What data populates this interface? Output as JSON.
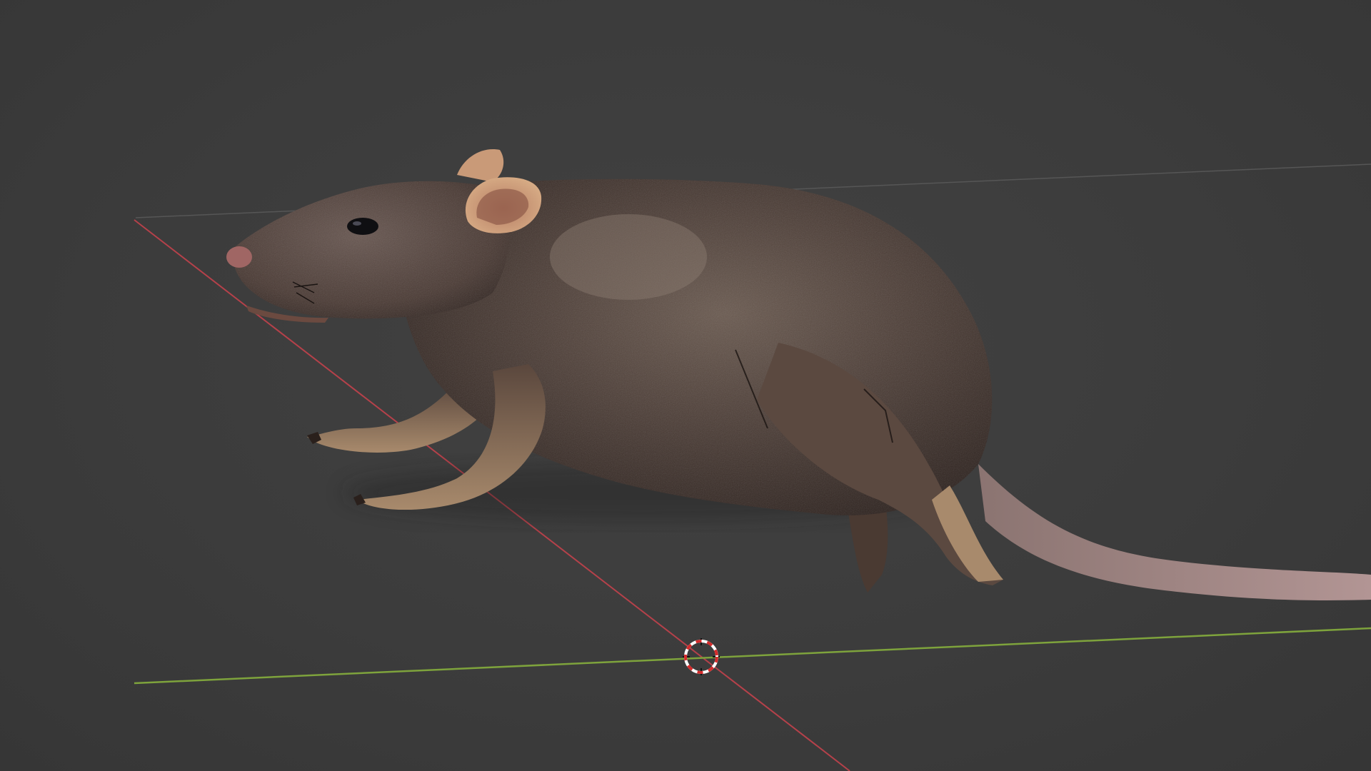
{
  "viewport": {
    "background_color": "#3d3d3d",
    "x_axis_color": "#b5414a",
    "y_axis_color": "#7ea33c",
    "grid_line_color": "#555555",
    "cursor_colors": [
      "#d42b2b",
      "#ffffff",
      "#111111"
    ]
  },
  "scene": {
    "object": "rat-model",
    "shading": "textured",
    "fur_color": "#4a3b34",
    "belly_color": "#8a735c",
    "ear_color": "#c99a78",
    "tail_color": "#a58a88",
    "paw_color": "#b79a80"
  }
}
